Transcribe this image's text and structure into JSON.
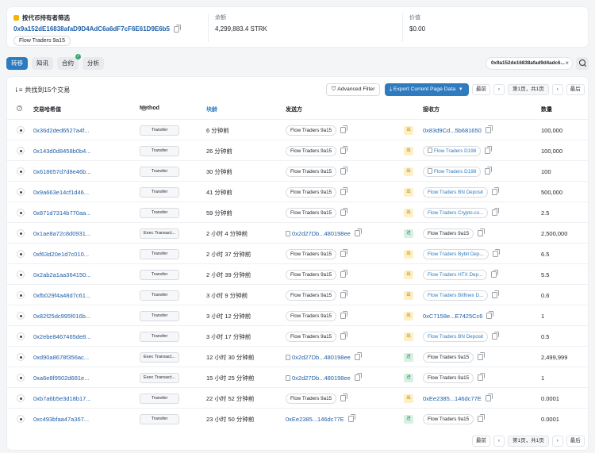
{
  "top": {
    "title": "按代币持有者筛选",
    "address": "0x9a152dE16838afaD9D4AdC6a6dF7cF6E61D9E6b5",
    "tag": "Flow Traders 9a15",
    "balance_label": "余额",
    "balance_value": "4,299,883.4 STRK",
    "value_label": "价值",
    "value_value": "$0.00"
  },
  "tabs": [
    "转移",
    "知讯",
    "合约",
    "分析"
  ],
  "filter_chip": "0x9a152de16838afad9d4adc6...",
  "toolbar": {
    "count_text": "共找到15个交易",
    "advanced_filter": "Advanced Filter",
    "export": "Export Current Page Data"
  },
  "pager": {
    "first": "最前",
    "prev": "‹",
    "info": "第1页，共1页",
    "next": "›",
    "last": "最后"
  },
  "columns": {
    "hash": "交易哈希值",
    "method": "Method",
    "age": "块龄",
    "from": "发送方",
    "to": "接收方",
    "qty": "数量"
  },
  "rows": [
    {
      "hash": "0x36d2ded6527a4f...",
      "method": "Transfer",
      "age": "6 分钟前",
      "from": "Flow Traders 9a15",
      "from_type": "pill",
      "dir": "出",
      "dir_type": "out",
      "to": "0x83d9Cd...5b681650",
      "to_type": "link",
      "qty": "100,000"
    },
    {
      "hash": "0x143d0d8458b0b4...",
      "method": "Transfer",
      "age": "26 分钟前",
      "from": "Flow Traders 9a15",
      "from_type": "pill",
      "dir": "出",
      "dir_type": "out",
      "to": "Flow Traders D198",
      "to_type": "pilldoc",
      "qty": "100,000"
    },
    {
      "hash": "0x618657d7d8e46b...",
      "method": "Transfer",
      "age": "30 分钟前",
      "from": "Flow Traders 9a15",
      "from_type": "pill",
      "dir": "出",
      "dir_type": "out",
      "to": "Flow Traders D198",
      "to_type": "pilldoc",
      "qty": "100"
    },
    {
      "hash": "0x9a663e14cf1d46...",
      "method": "Transfer",
      "age": "41 分钟前",
      "from": "Flow Traders 9a15",
      "from_type": "pill",
      "dir": "出",
      "dir_type": "out",
      "to": "Flow Traders BN Deposit",
      "to_type": "pillblue",
      "qty": "500,000"
    },
    {
      "hash": "0x871d7314b770aa...",
      "method": "Transfer",
      "age": "59 分钟前",
      "from": "Flow Traders 9a15",
      "from_type": "pill",
      "dir": "出",
      "dir_type": "out",
      "to": "Flow Traders Crypto.co...",
      "to_type": "pillblue",
      "qty": "2.5"
    },
    {
      "hash": "0x1ae8a72c8d0931...",
      "method": "Exec Transact...",
      "age": "2 小时 4 分钟前",
      "from": "0x2d27Db...480198ee",
      "from_type": "doclink",
      "dir": "进",
      "dir_type": "in",
      "to": "Flow Traders 9a15",
      "to_type": "pill",
      "qty": "2,500,000"
    },
    {
      "hash": "0xf63d20e1d7c010...",
      "method": "Transfer",
      "age": "2 小时 37 分钟前",
      "from": "Flow Traders 9a15",
      "from_type": "pill",
      "dir": "出",
      "dir_type": "out",
      "to": "Flow Traders Bybit Dep...",
      "to_type": "pillblue",
      "qty": "6.5"
    },
    {
      "hash": "0x2ab2a1aa364150...",
      "method": "Transfer",
      "age": "2 小时 39 分钟前",
      "from": "Flow Traders 9a15",
      "from_type": "pill",
      "dir": "出",
      "dir_type": "out",
      "to": "Flow Traders HTX Dep...",
      "to_type": "pillblue",
      "qty": "5.5"
    },
    {
      "hash": "0xfb029f4a48d7c61...",
      "method": "Transfer",
      "age": "3 小时 9 分钟前",
      "from": "Flow Traders 9a15",
      "from_type": "pill",
      "dir": "出",
      "dir_type": "out",
      "to": "Flow Traders Bitfinex D...",
      "to_type": "pillblue",
      "qty": "0.6"
    },
    {
      "hash": "0x82f25dc995f016b...",
      "method": "Transfer",
      "age": "3 小时 12 分钟前",
      "from": "Flow Traders 9a15",
      "from_type": "pill",
      "dir": "出",
      "dir_type": "out",
      "to": "0xC7158e...E7425Cc6",
      "to_type": "link",
      "qty": "1"
    },
    {
      "hash": "0x2ebe8467465de8...",
      "method": "Transfer",
      "age": "3 小时 17 分钟前",
      "from": "Flow Traders 9a15",
      "from_type": "pill",
      "dir": "出",
      "dir_type": "out",
      "to": "Flow Traders BN Deposit",
      "to_type": "pillblue",
      "qty": "0.5"
    },
    {
      "hash": "0xd90a8678f356ac...",
      "method": "Exec Transact...",
      "age": "12 小时 30 分钟前",
      "from": "0x2d27Db...480198ee",
      "from_type": "doclink",
      "dir": "进",
      "dir_type": "in",
      "to": "Flow Traders 9a15",
      "to_type": "pill",
      "qty": "2,499,999"
    },
    {
      "hash": "0xa6e8f9502d681e...",
      "method": "Exec Transact...",
      "age": "15 小时 25 分钟前",
      "from": "0x2d27Db...480198ee",
      "from_type": "doclink",
      "dir": "进",
      "dir_type": "in",
      "to": "Flow Traders 9a15",
      "to_type": "pill",
      "qty": "1"
    },
    {
      "hash": "0xb7a6b5e3d18b17...",
      "method": "Transfer",
      "age": "22 小时 52 分钟前",
      "from": "Flow Traders 9a15",
      "from_type": "pill",
      "dir": "出",
      "dir_type": "out",
      "to": "0xEe2385...146dc77E",
      "to_type": "link",
      "qty": "0.0001"
    },
    {
      "hash": "0xc493bfaa47a367...",
      "method": "Transfer",
      "age": "23 小时 50 分钟前",
      "from": "0xEe2385...146dc77E",
      "from_type": "link",
      "dir": "进",
      "dir_type": "in",
      "to": "Flow Traders 9a15",
      "to_type": "pill",
      "qty": "0.0001"
    }
  ]
}
